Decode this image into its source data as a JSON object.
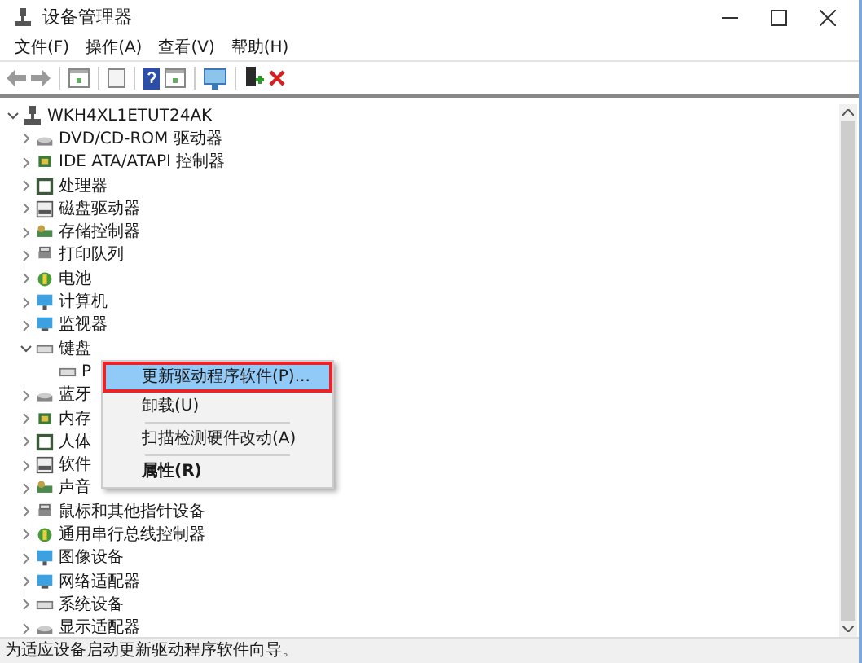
{
  "window": {
    "title": "设备管理器"
  },
  "menu": [
    "文件(F)",
    "操作(A)",
    "查看(V)",
    "帮助(H)"
  ],
  "tree": {
    "label": "WKH4XL1ETUT24AK",
    "expanded": true,
    "children": [
      {
        "label": "DVD/CD-ROM 驱动器",
        "expanded": false
      },
      {
        "label": "IDE ATA/ATAPI 控制器",
        "expanded": false
      },
      {
        "label": "处理器",
        "expanded": false
      },
      {
        "label": "磁盘驱动器",
        "expanded": false
      },
      {
        "label": "存储控制器",
        "expanded": false
      },
      {
        "label": "打印队列",
        "expanded": false
      },
      {
        "label": "电池",
        "expanded": false
      },
      {
        "label": "计算机",
        "expanded": false
      },
      {
        "label": "监视器",
        "expanded": false
      },
      {
        "label": "键盘",
        "expanded": true,
        "children": [
          {
            "label": "P"
          }
        ]
      },
      {
        "label": "蓝牙",
        "expanded": false
      },
      {
        "label": "内存",
        "expanded": false
      },
      {
        "label": "人体",
        "expanded": false
      },
      {
        "label": "软件",
        "expanded": false
      },
      {
        "label": "声音",
        "expanded": false
      },
      {
        "label": "鼠标和其他指针设备",
        "expanded": false
      },
      {
        "label": "通用串行总线控制器",
        "expanded": false
      },
      {
        "label": "图像设备",
        "expanded": false
      },
      {
        "label": "网络适配器",
        "expanded": false
      },
      {
        "label": "系统设备",
        "expanded": false
      },
      {
        "label": "显示适配器",
        "expanded": false
      }
    ]
  },
  "context_menu": {
    "items": [
      {
        "kind": "item",
        "label": "更新驱动程序软件(P)...",
        "selected": true,
        "annotated": true,
        "default": false
      },
      {
        "kind": "item",
        "label": "卸载(U)",
        "selected": false,
        "annotated": false,
        "default": false
      },
      {
        "kind": "separator"
      },
      {
        "kind": "item",
        "label": "扫描检测硬件改动(A)",
        "selected": false,
        "annotated": false,
        "default": false
      },
      {
        "kind": "separator"
      },
      {
        "kind": "item",
        "label": "属性(R)",
        "selected": false,
        "annotated": false,
        "default": true
      }
    ]
  },
  "status_bar": "为适应设备启动更新驱动程序软件向导。"
}
